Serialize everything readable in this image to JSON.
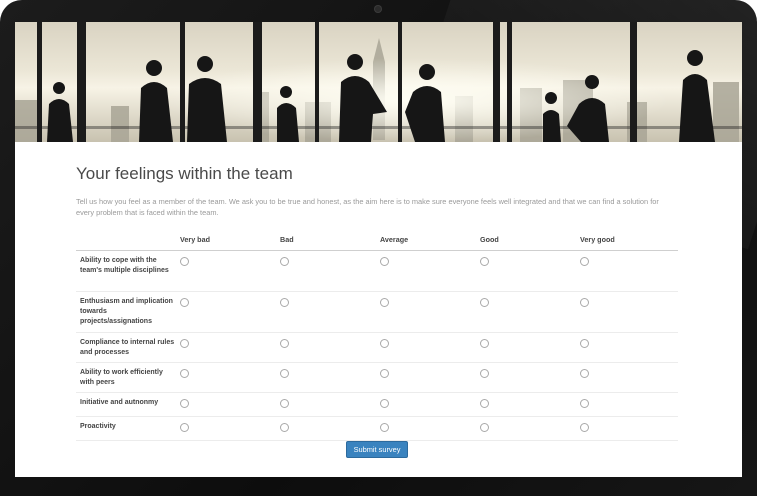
{
  "survey": {
    "title": "Your feelings within the team",
    "intro": "Tell us how you feel as a member of the team. We ask you to be true and honest, as the aim here is to make sure everyone feels well integrated and that we can find a solution for every problem that is faced within the team.",
    "columns": [
      "Very bad",
      "Bad",
      "Average",
      "Good",
      "Very good"
    ],
    "rows": [
      "Ability to cope with the team's multiple disciplines",
      "Enthusiasm and implication towards projects/assignations",
      "Compliance to internal rules and processes",
      "Ability to work efficiently with peers",
      "Initiative and autnonmy",
      "Proactivity"
    ],
    "submit_label": "Submit survey"
  },
  "colors": {
    "accent": "#3a83bf",
    "title": "#4a4a4a",
    "intro": "#9a9a9a"
  },
  "icons": {
    "hero": "business-people-silhouettes-photo",
    "camera": "webcam-icon",
    "option": "radio-button-icon"
  }
}
